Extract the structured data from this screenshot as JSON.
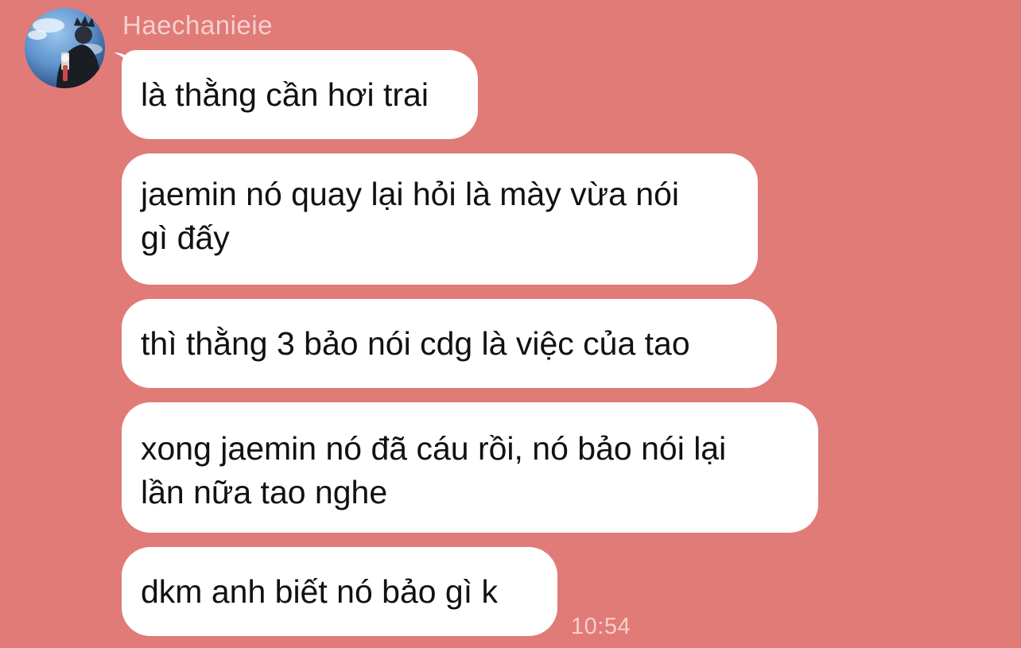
{
  "chat": {
    "sender_name": "Haechanieie",
    "timestamp": "10:54",
    "messages": [
      {
        "text": "là thằng cần hơi trai"
      },
      {
        "text": "jaemin nó quay lại hỏi là mày vừa nói\ngì đấy"
      },
      {
        "text": "thì thằng 3 bảo nói cdg là việc của tao"
      },
      {
        "text": "xong jaemin nó đã cáu rồi, nó bảo nói lại\nlần nữa tao nghe"
      },
      {
        "text": "dkm anh biết nó bảo gì k"
      }
    ]
  },
  "colors": {
    "background": "#E07B78",
    "bubble": "#FFFFFF",
    "meta_text": "#F6D0CD",
    "message_text": "#111111"
  }
}
